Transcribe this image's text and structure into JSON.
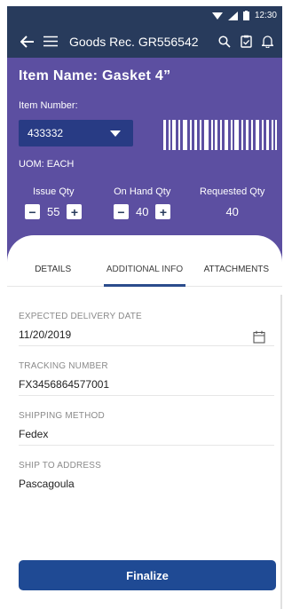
{
  "status_bar": {
    "time": "12:30"
  },
  "app_bar": {
    "title": "Goods Rec. GR556542"
  },
  "item": {
    "name": "Item Name: Gasket 4”",
    "number_label": "Item Number:",
    "number_value": "433332",
    "uom": "UOM: EACH"
  },
  "quantities": {
    "issue": {
      "label": "Issue Qty",
      "value": "55"
    },
    "on_hand": {
      "label": "On Hand Qty",
      "value": "40"
    },
    "requested": {
      "label": "Requested Qty",
      "value": "40"
    }
  },
  "tabs": [
    {
      "label": "DETAILS",
      "active": false
    },
    {
      "label": "ADDITIONAL INFO",
      "active": true
    },
    {
      "label": "ATTACHMENTS",
      "active": false
    }
  ],
  "fields": [
    {
      "label": "EXPECTED DELIVERY DATE",
      "value": "11/20/2019"
    },
    {
      "label": "TRACKING NUMBER",
      "value": "FX3456864577001"
    },
    {
      "label": "SHIPPING METHOD",
      "value": "Fedex"
    },
    {
      "label": "SHIP TO ADDRESS",
      "value": "Pascagoula"
    }
  ],
  "actions": {
    "finalize_label": "Finalize"
  },
  "colors": {
    "app_bar": "#283b5c",
    "hero": "#5c4fa1",
    "select": "#283b84",
    "primary_button": "#1f4a94",
    "active_tab_indicator": "#2b4c8c"
  },
  "icons": [
    "wifi-icon",
    "signal-icon",
    "battery-icon",
    "back-arrow-icon",
    "menu-icon",
    "search-icon",
    "clipboard-icon",
    "bell-icon",
    "barcode-icon",
    "calendar-icon"
  ]
}
